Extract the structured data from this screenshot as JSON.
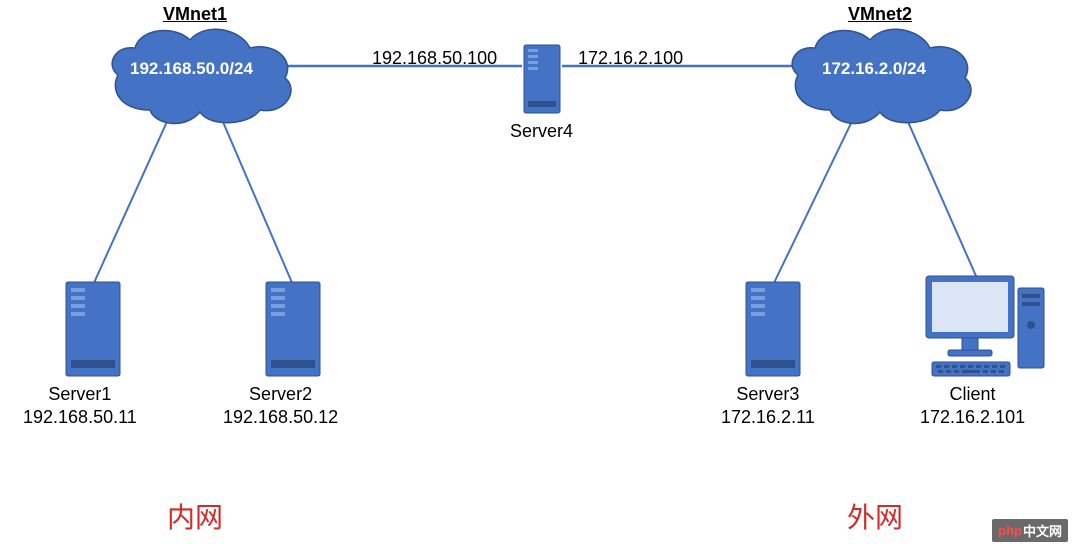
{
  "clouds": {
    "vmnet1": {
      "title": "VMnet1",
      "subnet": "192.168.50.0/24"
    },
    "vmnet2": {
      "title": "VMnet2",
      "subnet": "172.16.2.0/24"
    }
  },
  "router": {
    "name": "Server4",
    "ip_left": "192.168.50.100",
    "ip_right": "172.16.2.100"
  },
  "servers": {
    "s1": {
      "name": "Server1",
      "ip": "192.168.50.11"
    },
    "s2": {
      "name": "Server2",
      "ip": "192.168.50.12"
    },
    "s3": {
      "name": "Server3",
      "ip": "172.16.2.11"
    }
  },
  "client": {
    "name": "Client",
    "ip": "172.16.2.101"
  },
  "zones": {
    "inner": "内网",
    "outer": "外网"
  },
  "watermark": {
    "brand": "php",
    "suffix": "中文网"
  }
}
